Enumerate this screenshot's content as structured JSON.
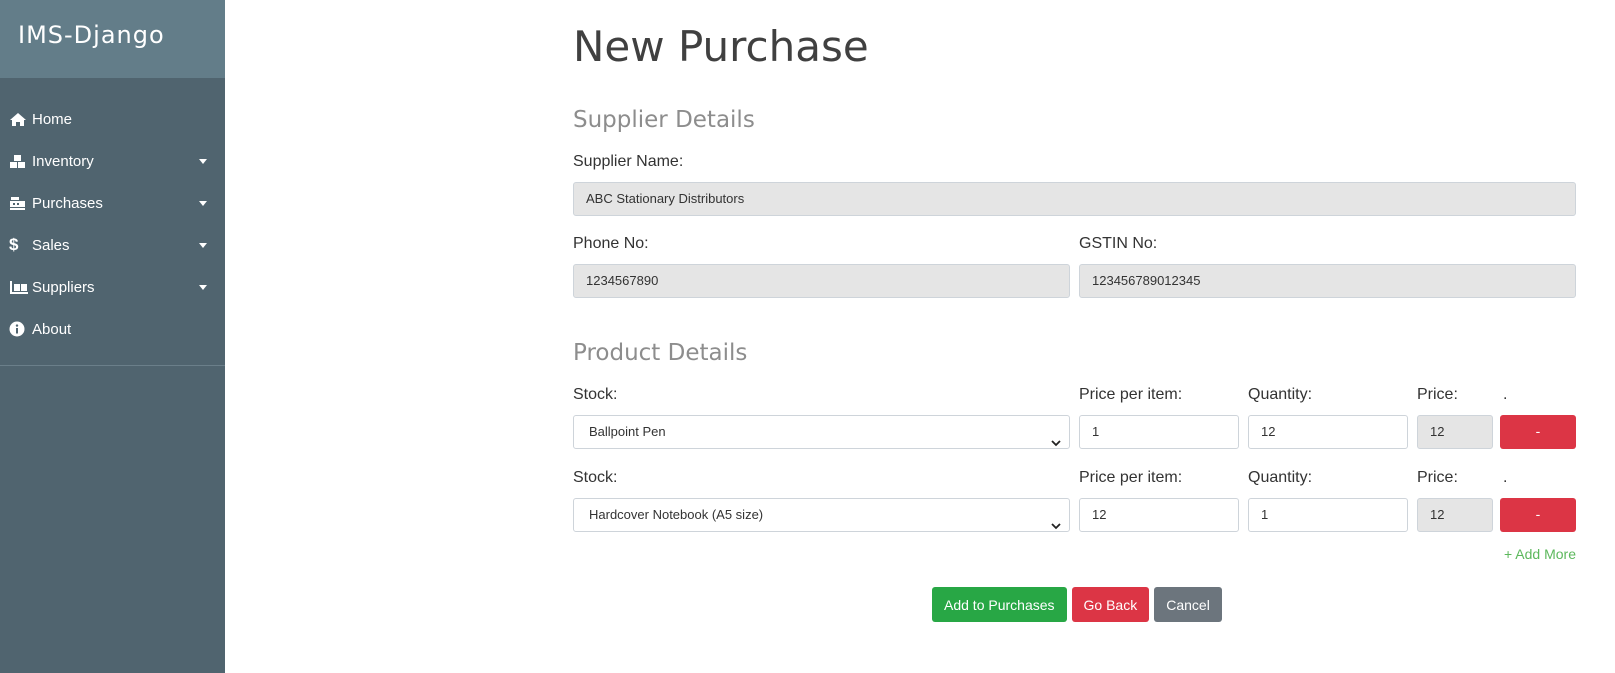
{
  "app": {
    "brand": "IMS-Django"
  },
  "sidebar": {
    "items": [
      {
        "label": "Home",
        "icon": "home-icon"
      },
      {
        "label": "Inventory",
        "icon": "boxes-icon"
      },
      {
        "label": "Purchases",
        "icon": "cash-register-icon"
      },
      {
        "label": "Sales",
        "icon": "dollar-icon"
      },
      {
        "label": "Suppliers",
        "icon": "dolly-icon"
      },
      {
        "label": "About",
        "icon": "info-icon"
      }
    ]
  },
  "main": {
    "title": "New Purchase",
    "supplier": {
      "heading": "Supplier Details",
      "name_label": "Supplier Name:",
      "name_value": "ABC Stationary Distributors",
      "phone_label": "Phone No:",
      "phone_value": "1234567890",
      "gstin_label": "GSTIN No:",
      "gstin_value": "123456789012345"
    },
    "products": {
      "heading": "Product Details",
      "rows": [
        {
          "stock_label": "Stock:",
          "stock_value": "Ballpoint Pen",
          "ppi_label": "Price per item:",
          "ppi_value": "1",
          "qty_label": "Quantity:",
          "qty_value": "12",
          "price_label": "Price:",
          "price_value": "12",
          "extra_label": ".",
          "remove_label": "-"
        },
        {
          "stock_label": "Stock:",
          "stock_value": "Hardcover Notebook (A5 size)",
          "ppi_label": "Price per item:",
          "ppi_value": "12",
          "qty_label": "Quantity:",
          "qty_value": "1",
          "price_label": "Price:",
          "price_value": "12",
          "extra_label": ".",
          "remove_label": "-"
        }
      ],
      "add_more": "+ Add More"
    },
    "actions": {
      "submit": "Add to Purchases",
      "back": "Go Back",
      "cancel": "Cancel"
    }
  },
  "colors": {
    "sidebar": "#50646f",
    "brand_bar": "#637d89",
    "success": "#28a745",
    "danger": "#dc3545",
    "secondary": "#6c757d"
  }
}
